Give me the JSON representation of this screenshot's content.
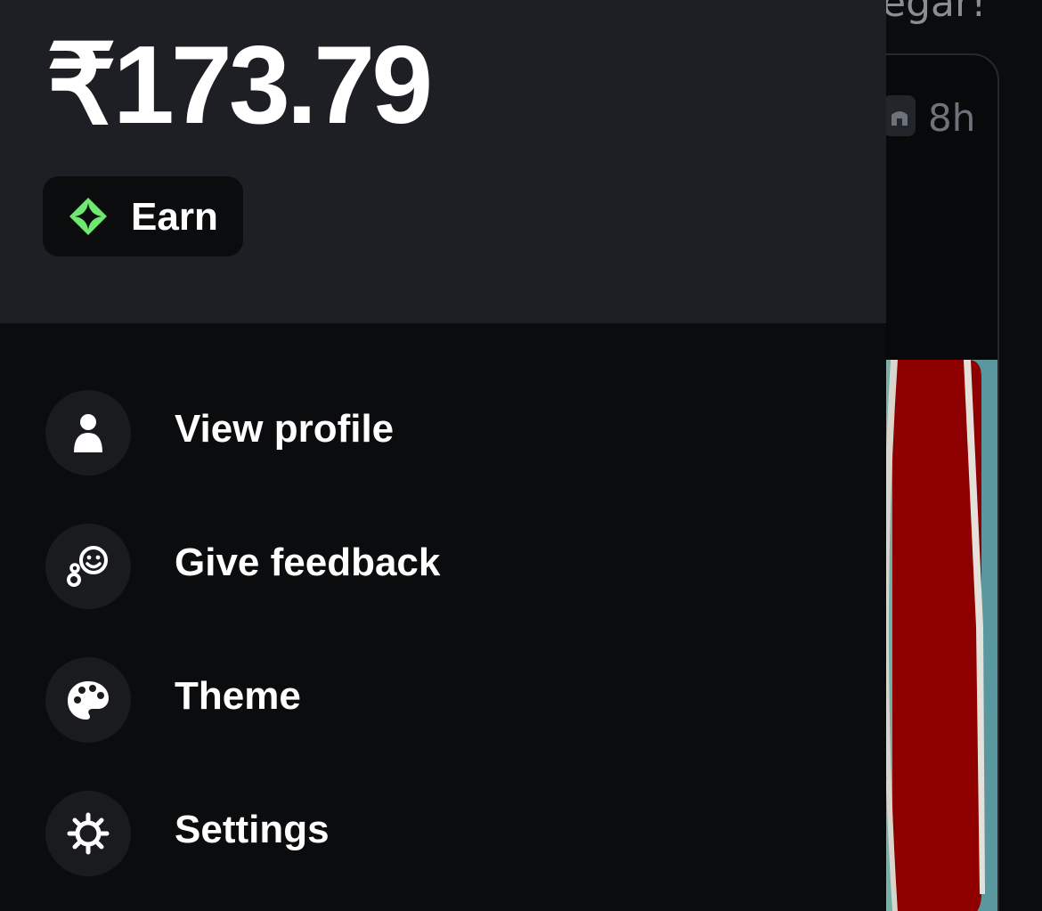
{
  "background": {
    "title_fragment": "egar!",
    "card_time": "8h"
  },
  "wallet": {
    "balance": "₹173.79"
  },
  "earn": {
    "label": "Earn",
    "icon": "diamond-star-icon",
    "icon_color": "#6ee86e"
  },
  "menu": {
    "items": [
      {
        "label": "View profile",
        "icon": "person-icon"
      },
      {
        "label": "Give feedback",
        "icon": "feedback-smiley-icon"
      },
      {
        "label": "Theme",
        "icon": "palette-icon"
      },
      {
        "label": "Settings",
        "icon": "gear-icon"
      }
    ]
  },
  "colors": {
    "drawer_header": "#1e1f24",
    "drawer_body": "#0b0c0e",
    "icon_circle": "#1a1b1f",
    "text": "#ffffff"
  }
}
